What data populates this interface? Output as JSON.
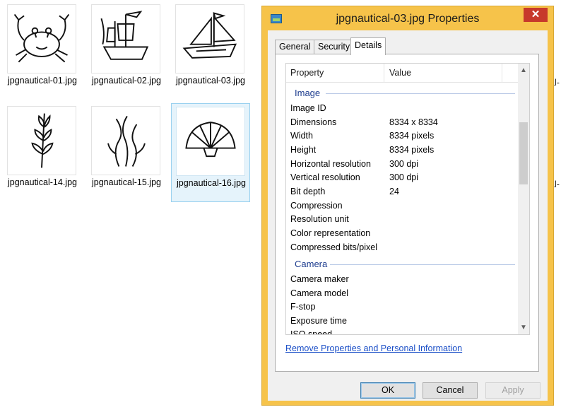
{
  "explorer": {
    "files": [
      {
        "name": "jpgnautical-01.jpg",
        "icon": "crab-icon"
      },
      {
        "name": "jpgnautical-02.jpg",
        "icon": "pirate-ship-icon"
      },
      {
        "name": "jpgnautical-03.jpg",
        "icon": "sailboat-icon"
      },
      {
        "name": "jpgnautical-14.jpg",
        "icon": "leaf-branch-icon"
      },
      {
        "name": "jpgnautical-15.jpg",
        "icon": "seaweed-icon"
      },
      {
        "name": "jpgnautical-16.jpg",
        "icon": "seashell-icon"
      }
    ],
    "partial_right_1": "al-",
    "partial_right_2": "al-"
  },
  "dialog": {
    "title": "jpgnautical-03.jpg Properties",
    "close_glyph": "✕",
    "tabs": [
      "General",
      "Security",
      "Details"
    ],
    "active_tab": "Details",
    "columns": {
      "property": "Property",
      "value": "Value"
    },
    "groups": {
      "image": "Image",
      "camera": "Camera"
    },
    "image_rows": [
      {
        "p": "Image ID",
        "v": ""
      },
      {
        "p": "Dimensions",
        "v": "8334 x 8334"
      },
      {
        "p": "Width",
        "v": "8334 pixels"
      },
      {
        "p": "Height",
        "v": "8334 pixels"
      },
      {
        "p": "Horizontal resolution",
        "v": "300 dpi"
      },
      {
        "p": "Vertical resolution",
        "v": "300 dpi"
      },
      {
        "p": "Bit depth",
        "v": "24"
      },
      {
        "p": "Compression",
        "v": ""
      },
      {
        "p": "Resolution unit",
        "v": ""
      },
      {
        "p": "Color representation",
        "v": ""
      },
      {
        "p": "Compressed bits/pixel",
        "v": ""
      }
    ],
    "camera_rows": [
      {
        "p": "Camera maker",
        "v": ""
      },
      {
        "p": "Camera model",
        "v": ""
      },
      {
        "p": "F-stop",
        "v": ""
      },
      {
        "p": "Exposure time",
        "v": ""
      },
      {
        "p": "ISO speed",
        "v": ""
      }
    ],
    "remove_link": "Remove Properties and Personal Information",
    "buttons": {
      "ok": "OK",
      "cancel": "Cancel",
      "apply": "Apply"
    },
    "colors": {
      "frame": "#f6c34a",
      "close": "#c7392b",
      "group_text": "#1e3d8f",
      "link": "#1a4ec7"
    }
  }
}
